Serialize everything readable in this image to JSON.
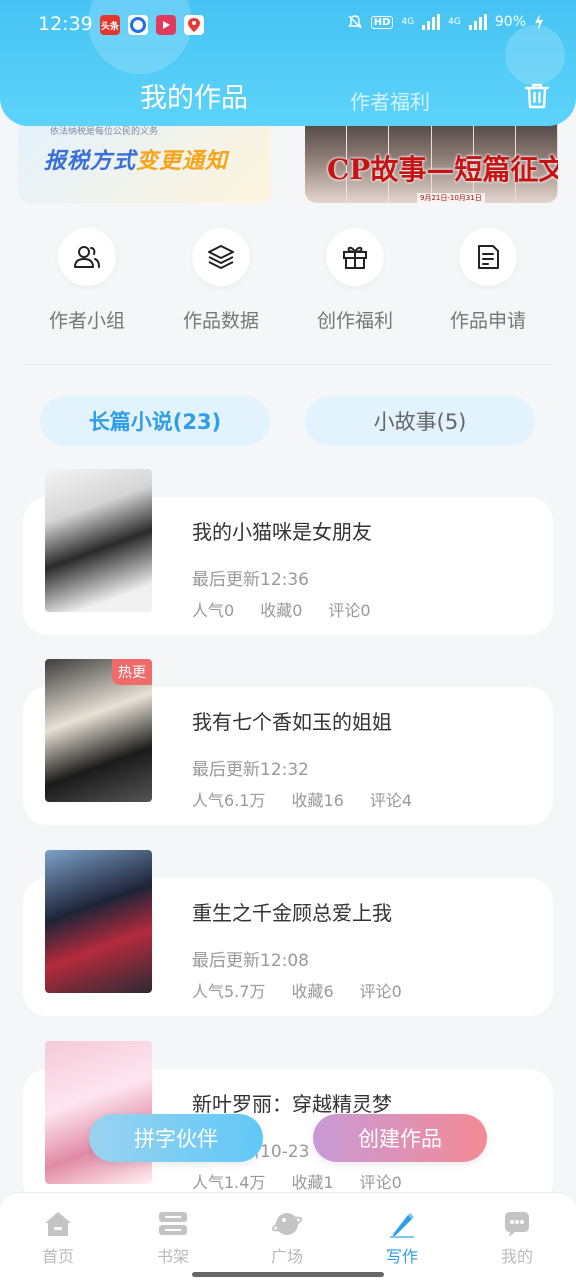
{
  "status_bar": {
    "time": "12:39",
    "notif_icons": [
      "toutiao-icon",
      "circle-app-icon",
      "video-app-icon",
      "map-app-icon"
    ],
    "toutiao_label": "头条",
    "hd_label": "HD",
    "net1": "4G",
    "net2": "4G",
    "battery": "90%"
  },
  "header": {
    "tab_works": "我的作品",
    "tab_benefits": "作者福利",
    "accent": "#46c3f3"
  },
  "banners": {
    "left_note": "依法纳税是每位公民的义务",
    "left_title_a": "报税方式",
    "left_title_b": "变更通知",
    "right_title": "CP故事—短篇征文",
    "right_date": "9月21日-10月31日"
  },
  "quick_actions": [
    {
      "label": "作者小组",
      "icon": "group-icon"
    },
    {
      "label": "作品数据",
      "icon": "layers-icon"
    },
    {
      "label": "创作福利",
      "icon": "gift-icon"
    },
    {
      "label": "作品申请",
      "icon": "document-icon"
    }
  ],
  "segments": {
    "novels": "长篇小说(23)",
    "stories": "小故事(5)"
  },
  "works": [
    {
      "title": "我的小猫咪是女朋友",
      "updated": "最后更新12:36",
      "popularity": "人气0",
      "favorites": "收藏0",
      "comments": "评论0",
      "badge": ""
    },
    {
      "title": "我有七个香如玉的姐姐",
      "updated": "最后更新12:32",
      "popularity": "人气6.1万",
      "favorites": "收藏16",
      "comments": "评论4",
      "badge": "热更"
    },
    {
      "title": "重生之千金顾总爱上我",
      "updated": "最后更新12:08",
      "popularity": "人气5.7万",
      "favorites": "收藏6",
      "comments": "评论0",
      "badge": ""
    },
    {
      "title": "新叶罗丽：穿越精灵梦",
      "updated": "最后更新10-23",
      "popularity": "人气1.4万",
      "favorites": "收藏1",
      "comments": "评论0",
      "badge": ""
    }
  ],
  "fabs": {
    "partner": "拼字伙伴",
    "create": "创建作品"
  },
  "bottom_nav": [
    {
      "label": "首页",
      "icon": "home-icon"
    },
    {
      "label": "书架",
      "icon": "bookshelf-icon"
    },
    {
      "label": "广场",
      "icon": "planet-icon"
    },
    {
      "label": "写作",
      "icon": "pen-icon"
    },
    {
      "label": "我的",
      "icon": "chat-bubble-icon"
    }
  ],
  "nav_active": "写作",
  "nav_active_color": "#2e9ee8"
}
